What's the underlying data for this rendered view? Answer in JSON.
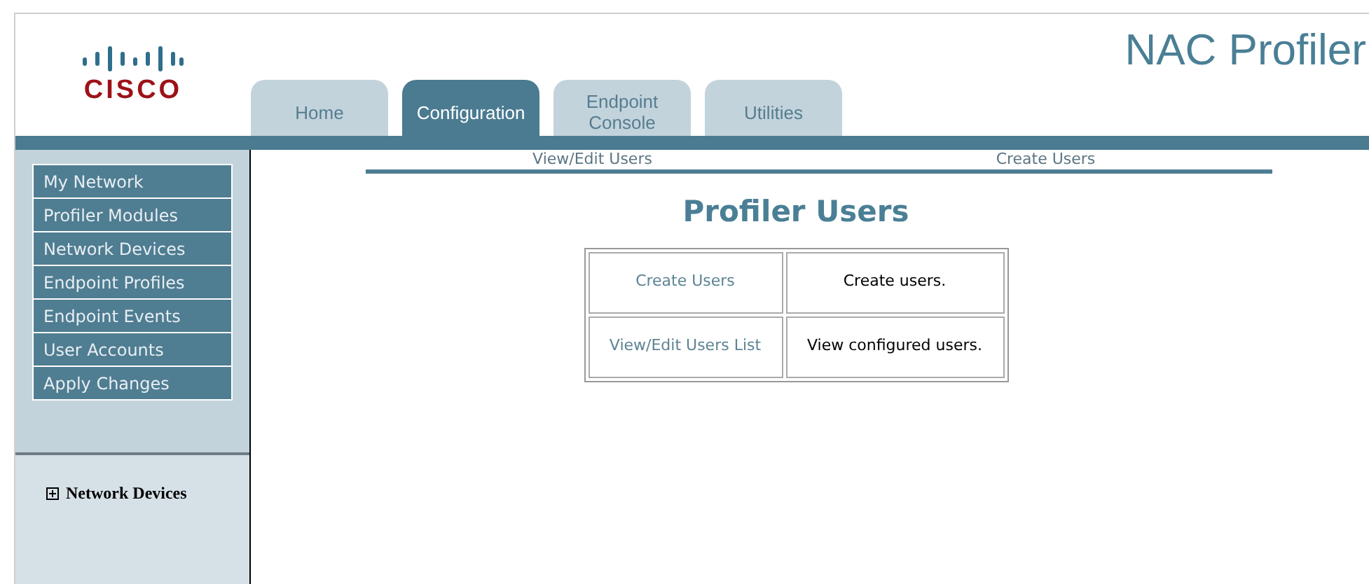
{
  "header": {
    "logo": "CISCO",
    "product_title": "NAC Profiler"
  },
  "tabs": [
    {
      "label": "Home",
      "selected": false
    },
    {
      "label": "Configuration",
      "selected": true
    },
    {
      "label": "Endpoint Console",
      "selected": false
    },
    {
      "label": "Utilities",
      "selected": false
    }
  ],
  "sidebar": {
    "items": [
      "My Network",
      "Profiler Modules",
      "Network Devices",
      "Endpoint Profiles",
      "Endpoint Events",
      "User Accounts",
      "Apply Changes"
    ],
    "tree": [
      {
        "label": "Network Devices",
        "expanded": false
      }
    ]
  },
  "subnav": [
    "View/Edit Users",
    "Create Users"
  ],
  "page_title": "Profiler Users",
  "table": {
    "rows": [
      {
        "link": "Create Users",
        "description": "Create users."
      },
      {
        "link": "View/Edit Users List",
        "description": "View configured users."
      }
    ]
  }
}
